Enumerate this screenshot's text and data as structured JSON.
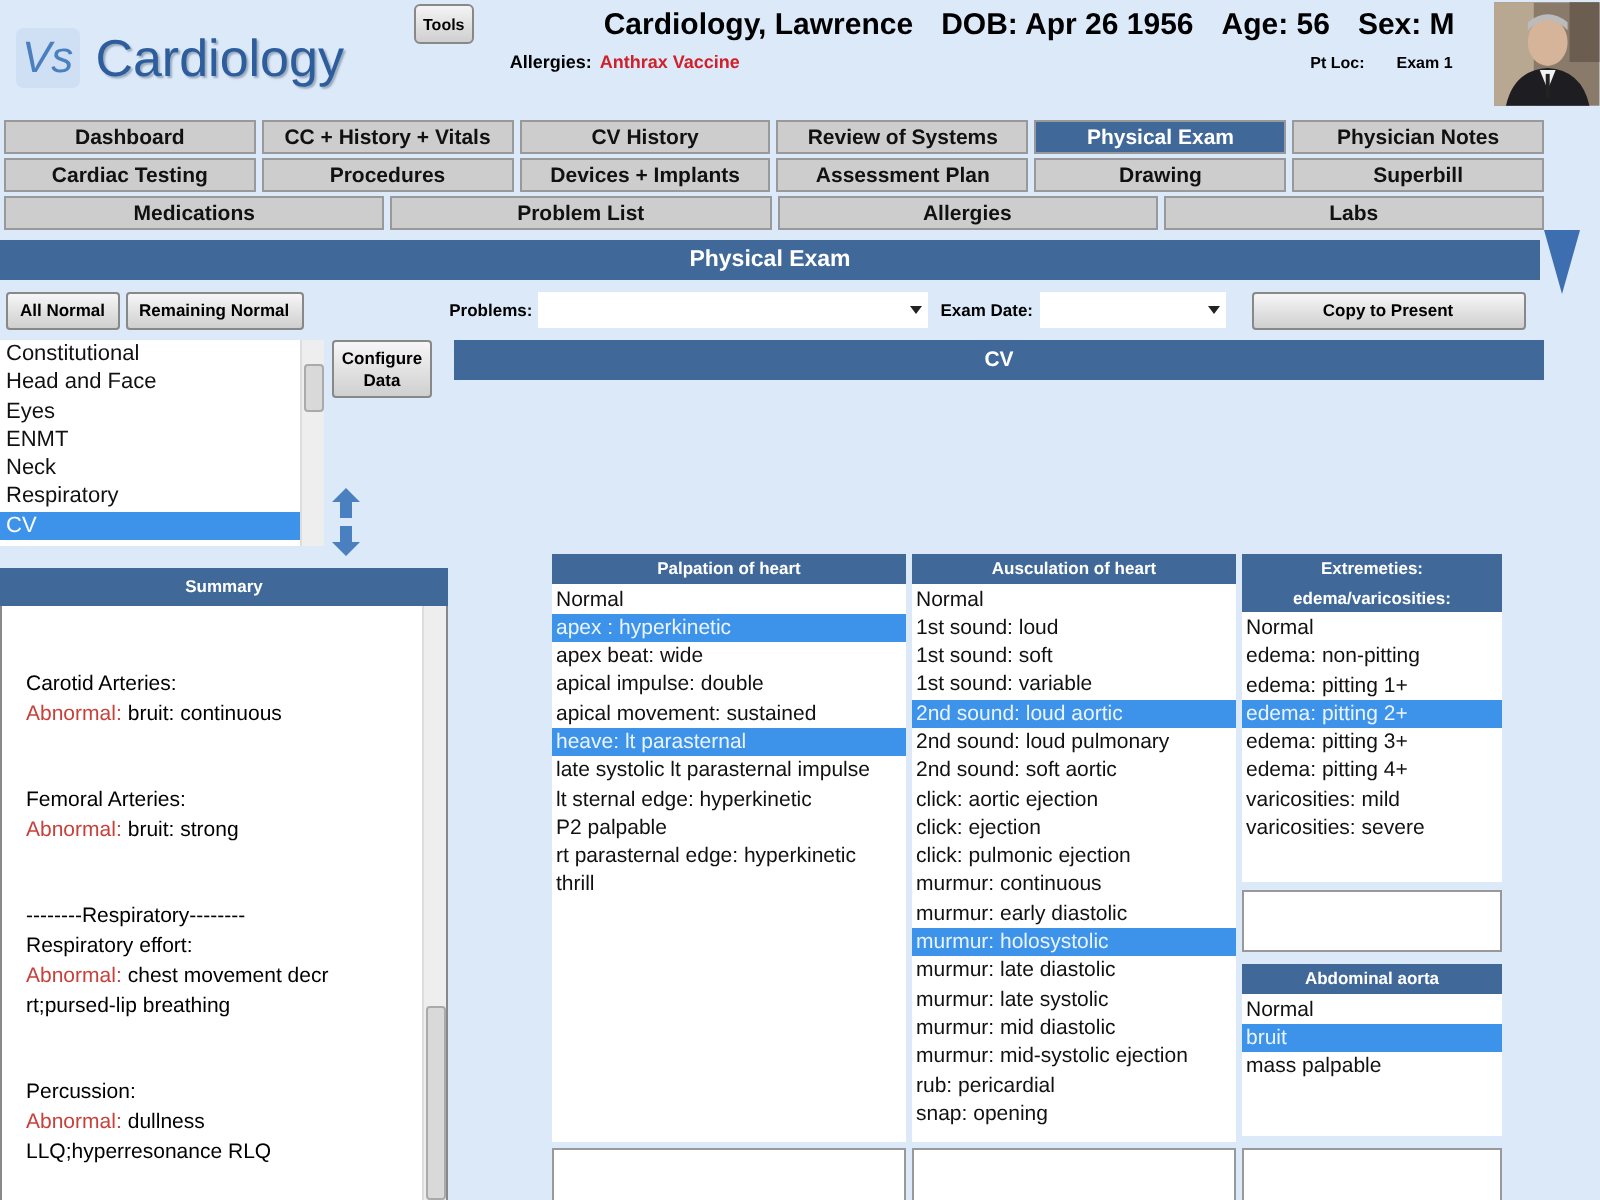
{
  "app": {
    "logo": "Vs",
    "title": "Cardiology"
  },
  "tools_button": "Tools",
  "patient": {
    "name": "Cardiology, Lawrence",
    "dob": "DOB: Apr 26 1956",
    "age": "Age: 56",
    "sex": "Sex: M",
    "allergies_label": "Allergies:",
    "allergies": "Anthrax Vaccine",
    "pt_loc_label": "Pt Loc:",
    "pt_loc": "Exam 1"
  },
  "tab_rows": [
    [
      {
        "label": "Dashboard",
        "selected": false
      },
      {
        "label": "CC + History + Vitals",
        "selected": false
      },
      {
        "label": "CV History",
        "selected": false
      },
      {
        "label": "Review of Systems",
        "selected": false
      },
      {
        "label": "Physical Exam",
        "selected": true
      },
      {
        "label": "Physician Notes",
        "selected": false
      }
    ],
    [
      {
        "label": "Cardiac Testing",
        "selected": false
      },
      {
        "label": "Procedures",
        "selected": false
      },
      {
        "label": "Devices + Implants",
        "selected": false
      },
      {
        "label": "Assessment Plan",
        "selected": false
      },
      {
        "label": "Drawing",
        "selected": false
      },
      {
        "label": "Superbill",
        "selected": false
      }
    ],
    [
      {
        "label": "Medications",
        "selected": false
      },
      {
        "label": "Problem List",
        "selected": false
      },
      {
        "label": "Allergies",
        "selected": false
      },
      {
        "label": "Labs",
        "selected": false
      }
    ]
  ],
  "section_title": "Physical Exam",
  "action_buttons": [
    "All Normal",
    "Remaining Normal"
  ],
  "problems_label": "Problems:",
  "exam_date_label": "Exam Date:",
  "copy_button": "Copy to Present",
  "systems": [
    {
      "label": "Constitutional",
      "selected": false
    },
    {
      "label": "Head and Face",
      "selected": false
    },
    {
      "label": "Eyes",
      "selected": false
    },
    {
      "label": "ENMT",
      "selected": false
    },
    {
      "label": "Neck",
      "selected": false
    },
    {
      "label": "Respiratory",
      "selected": false
    },
    {
      "label": "CV",
      "selected": true
    }
  ],
  "configure_button": "Configure Data",
  "subsection": "CV",
  "summary": {
    "title": "Summary",
    "entries": [
      {
        "kind": "finding",
        "heading": "Carotid Arteries:",
        "status": "Abnormal:",
        "text": "bruit: continuous"
      },
      {
        "kind": "finding",
        "heading": "Femoral Arteries:",
        "status": "Abnormal:",
        "text": "bruit: strong"
      },
      {
        "kind": "divider",
        "heading": "--------Respiratory--------"
      },
      {
        "kind": "finding",
        "heading": "Respiratory effort:",
        "status": "Abnormal:",
        "text": "chest movement decr rt;pursed-lip breathing"
      },
      {
        "kind": "finding",
        "heading": "Percussion:",
        "status": "Abnormal:",
        "text": "dullness LLQ;hyperresonance RLQ"
      }
    ]
  },
  "panels": [
    {
      "title": "Palpation of heart",
      "items": [
        {
          "label": "Normal",
          "selected": false
        },
        {
          "label": "apex : hyperkinetic",
          "selected": true
        },
        {
          "label": "apex beat: wide",
          "selected": false
        },
        {
          "label": "apical impulse: double",
          "selected": false
        },
        {
          "label": "apical movement: sustained",
          "selected": false
        },
        {
          "label": "heave: lt parasternal",
          "selected": true
        },
        {
          "label": "late systolic lt parasternal impulse",
          "selected": false
        },
        {
          "label": "lt sternal edge: hyperkinetic",
          "selected": false
        },
        {
          "label": "P2 palpable",
          "selected": false
        },
        {
          "label": "rt parasternal edge: hyperkinetic",
          "selected": false
        },
        {
          "label": "thrill",
          "selected": false
        }
      ]
    },
    {
      "title": "Ausculation of heart",
      "items": [
        {
          "label": "Normal",
          "selected": false
        },
        {
          "label": "1st sound: loud",
          "selected": false
        },
        {
          "label": "1st sound: soft",
          "selected": false
        },
        {
          "label": "1st sound: variable",
          "selected": false
        },
        {
          "label": "2nd sound: loud aortic",
          "selected": true
        },
        {
          "label": "2nd sound: loud pulmonary",
          "selected": false
        },
        {
          "label": "2nd sound: soft aortic",
          "selected": false
        },
        {
          "label": "click: aortic ejection",
          "selected": false
        },
        {
          "label": "click: ejection",
          "selected": false
        },
        {
          "label": "click: pulmonic ejection",
          "selected": false
        },
        {
          "label": "murmur: continuous",
          "selected": false
        },
        {
          "label": "murmur: early diastolic",
          "selected": false
        },
        {
          "label": "murmur: holosystolic",
          "selected": true
        },
        {
          "label": "murmur: late diastolic",
          "selected": false
        },
        {
          "label": "murmur: late systolic",
          "selected": false
        },
        {
          "label": "murmur: mid diastolic",
          "selected": false
        },
        {
          "label": "murmur: mid-systolic ejection",
          "selected": false
        },
        {
          "label": "rub: pericardial",
          "selected": false
        },
        {
          "label": "snap: opening",
          "selected": false
        }
      ]
    },
    {
      "title": "Extremeties: edema/varicosities:",
      "items": [
        {
          "label": "Normal",
          "selected": false
        },
        {
          "label": "edema: non-pitting",
          "selected": false
        },
        {
          "label": "edema: pitting 1+",
          "selected": false
        },
        {
          "label": "edema: pitting 2+",
          "selected": true
        },
        {
          "label": "edema: pitting 3+",
          "selected": false
        },
        {
          "label": "edema: pitting 4+",
          "selected": false
        },
        {
          "label": "varicosities: mild",
          "selected": false
        },
        {
          "label": "varicosities: severe",
          "selected": false
        }
      ]
    },
    {
      "title": "Abdominal aorta",
      "items": [
        {
          "label": "Normal",
          "selected": false
        },
        {
          "label": "bruit",
          "selected": true
        },
        {
          "label": "mass palpable",
          "selected": false
        }
      ]
    }
  ]
}
